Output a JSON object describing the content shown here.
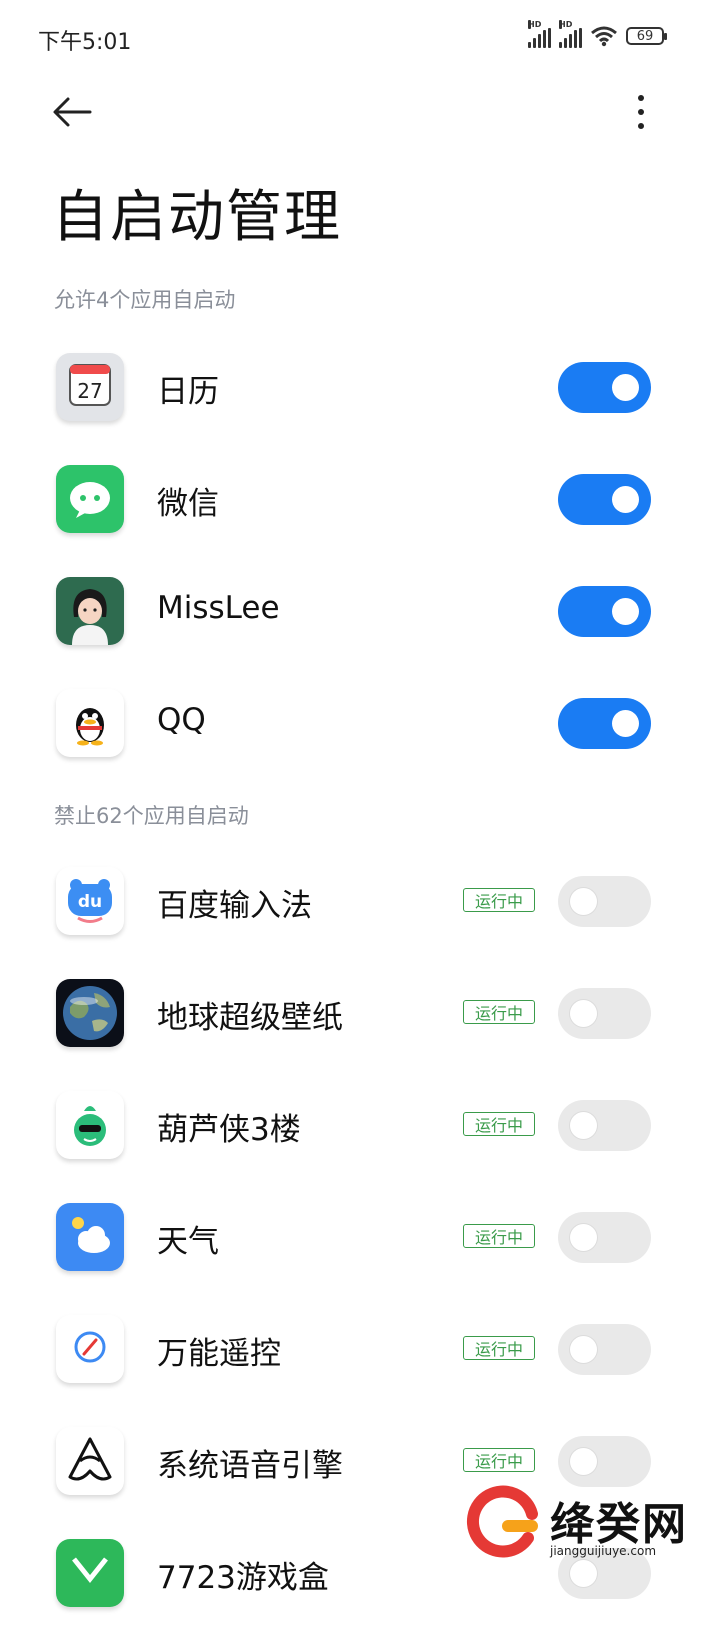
{
  "status_bar": {
    "time": "下午5:01",
    "battery": "69",
    "sim1_label": "HD",
    "sim2_label": "HD"
  },
  "toolbar": {
    "back_icon": "back-arrow-icon",
    "menu_icon": "more-vertical-icon"
  },
  "page": {
    "title": "自启动管理"
  },
  "allowed": {
    "header": "允许4个应用自启动",
    "apps": [
      {
        "name": "日历",
        "icon": "calendar-icon",
        "enabled": true,
        "calendar_day": "27"
      },
      {
        "name": "微信",
        "icon": "wechat-icon",
        "enabled": true
      },
      {
        "name": "MissLee",
        "icon": "misslee-icon",
        "enabled": true
      },
      {
        "name": "QQ",
        "icon": "qq-icon",
        "enabled": true
      }
    ]
  },
  "blocked": {
    "header": "禁止62个应用自启动",
    "apps": [
      {
        "name": "百度输入法",
        "icon": "baidu-input-icon",
        "icon_text": "du",
        "status": "运行中",
        "enabled": false
      },
      {
        "name": "地球超级壁纸",
        "icon": "earth-wallpaper-icon",
        "status": "运行中",
        "enabled": false
      },
      {
        "name": "葫芦侠3楼",
        "icon": "huluxia-icon",
        "status": "运行中",
        "enabled": false
      },
      {
        "name": "天气",
        "icon": "weather-icon",
        "status": "运行中",
        "enabled": false
      },
      {
        "name": "万能遥控",
        "icon": "remote-control-icon",
        "status": "运行中",
        "enabled": false
      },
      {
        "name": "系统语音引擎",
        "icon": "voice-engine-icon",
        "status": "运行中",
        "enabled": false
      },
      {
        "name": "7723游戏盒",
        "icon": "game-box-icon",
        "enabled": false
      }
    ]
  },
  "watermark": {
    "brand": "绛癸网",
    "url": "jiangguijiuye.com",
    "logo": "watermark-logo-icon"
  },
  "colors": {
    "accent": "#1a7cf3",
    "running_badge": "#3a9b4a",
    "section_header": "#8a8f99"
  }
}
